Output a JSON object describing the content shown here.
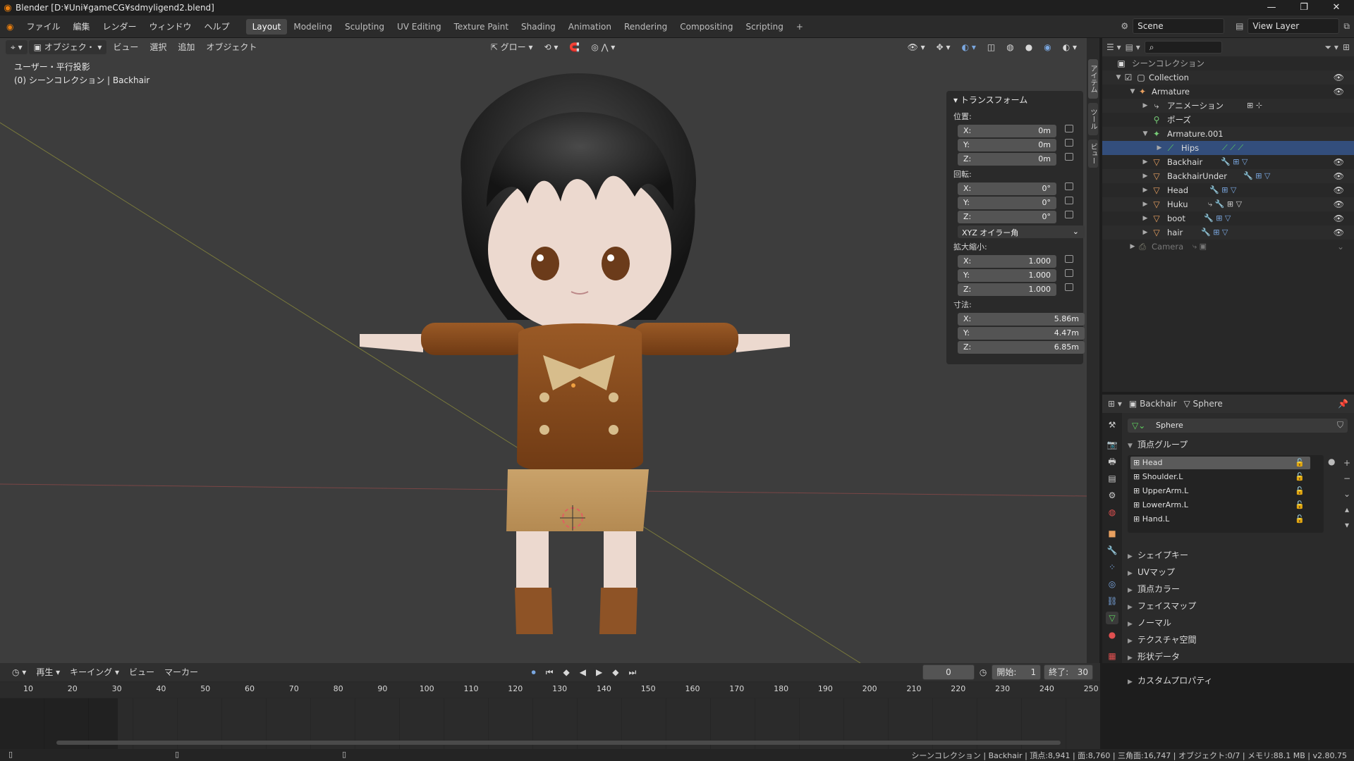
{
  "window": {
    "title": "Blender [D:¥Uni¥gameCG¥sdmyligend2.blend]",
    "min": "—",
    "max": "❐",
    "close": "✕"
  },
  "menu": [
    "ファイル",
    "編集",
    "レンダー",
    "ウィンドウ",
    "ヘルプ"
  ],
  "workspaces": [
    "Layout",
    "Modeling",
    "Sculpting",
    "UV Editing",
    "Texture Paint",
    "Shading",
    "Animation",
    "Rendering",
    "Compositing",
    "Scripting"
  ],
  "workspace_add": "+",
  "scene": {
    "name": "Scene",
    "view_layer": "View Layer"
  },
  "viewport": {
    "mode": "オブジェク・",
    "menus": [
      "ビュー",
      "選択",
      "追加",
      "オブジェクト"
    ],
    "transform_orientation": "グロー",
    "overlay_line1": "ユーザー・平行投影",
    "overlay_line2": "(0) シーンコレクション | Backhair"
  },
  "npanel": {
    "title": "トランスフォーム",
    "location_label": "位置:",
    "location": [
      {
        "axis": "X:",
        "value": "0m"
      },
      {
        "axis": "Y:",
        "value": "0m"
      },
      {
        "axis": "Z:",
        "value": "0m"
      }
    ],
    "rotation_label": "回転:",
    "rotation": [
      {
        "axis": "X:",
        "value": "0°"
      },
      {
        "axis": "Y:",
        "value": "0°"
      },
      {
        "axis": "Z:",
        "value": "0°"
      }
    ],
    "rotation_mode": "XYZ オイラー角",
    "scale_label": "拡大縮小:",
    "scale": [
      {
        "axis": "X:",
        "value": "1.000"
      },
      {
        "axis": "Y:",
        "value": "1.000"
      },
      {
        "axis": "Z:",
        "value": "1.000"
      }
    ],
    "dimensions_label": "寸法:",
    "dimensions": [
      {
        "axis": "X:",
        "value": "5.86m"
      },
      {
        "axis": "Y:",
        "value": "4.47m"
      },
      {
        "axis": "Z:",
        "value": "6.85m"
      }
    ],
    "tabs": [
      "アイテム",
      "ツール",
      "ビュー"
    ]
  },
  "outliner": {
    "root": "シーンコレクション",
    "rows": [
      {
        "label": "Collection",
        "icon": "collection-icon"
      },
      {
        "label": "Armature",
        "icon": "armature-icon"
      },
      {
        "label": "アニメーション",
        "icon": "animation-icon"
      },
      {
        "label": "ポーズ",
        "icon": "pose-icon"
      },
      {
        "label": "Armature.001",
        "icon": "armature-data-icon"
      },
      {
        "label": "Hips",
        "icon": "bone-icon"
      },
      {
        "label": "Backhair",
        "icon": "mesh-icon"
      },
      {
        "label": "BackhairUnder",
        "icon": "mesh-icon"
      },
      {
        "label": "Head",
        "icon": "mesh-icon"
      },
      {
        "label": "Huku",
        "icon": "mesh-icon"
      },
      {
        "label": "boot",
        "icon": "mesh-icon"
      },
      {
        "label": "hair",
        "icon": "mesh-icon"
      },
      {
        "label": "Camera",
        "icon": "camera-icon"
      }
    ]
  },
  "properties": {
    "object_name": "Backhair",
    "data_name": "Sphere",
    "mesh_field": "Sphere",
    "vertex_groups_title": "頂点グループ",
    "vertex_groups": [
      "Head",
      "Shoulder.L",
      "UpperArm.L",
      "LowerArm.L",
      "Hand.L"
    ],
    "sections": [
      "シェイプキー",
      "UVマップ",
      "頂点カラー",
      "フェイスマップ",
      "ノーマル",
      "テクスチャ空間",
      "形状データ",
      "カスタムプロパティ"
    ]
  },
  "timeline": {
    "menus": [
      "再生",
      "キーイング",
      "ビュー",
      "マーカー"
    ],
    "current_frame": "0",
    "start_label": "開始:",
    "start": "1",
    "end_label": "終了:",
    "end": "30",
    "ruler": [
      "10",
      "20",
      "30",
      "40",
      "50",
      "60",
      "70",
      "80",
      "90",
      "100",
      "110",
      "120",
      "130",
      "140",
      "150",
      "160",
      "170",
      "180",
      "190",
      "200",
      "210",
      "220",
      "230",
      "240",
      "250"
    ]
  },
  "status": "シーンコレクション | Backhair | 頂点:8,941 | 面:8,760 | 三角面:16,747 | オブジェクト:0/7 | メモリ:88.1 MB | v2.80.75"
}
